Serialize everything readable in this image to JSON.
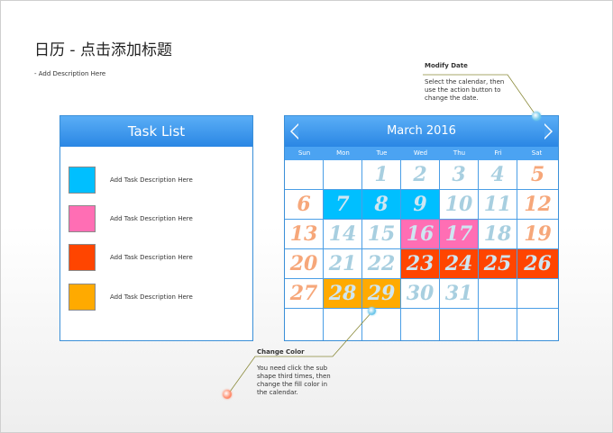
{
  "title": "日历 - 点击添加标题",
  "subtitle": "- Add Description Here",
  "task_list": {
    "header": "Task List",
    "items": [
      {
        "color": "#00bfff",
        "label": "Add Task  Description Here"
      },
      {
        "color": "#ff6eb4",
        "label": "Add Task  Description Here"
      },
      {
        "color": "#ff4500",
        "label": "Add Task  Description Here"
      },
      {
        "color": "#ffaa00",
        "label": "Add Task  Description Here"
      }
    ]
  },
  "calendar": {
    "month": "March 2016",
    "weekdays": [
      "Sun",
      "Mon",
      "Tue",
      "Wed",
      "Thu",
      "Fri",
      "Sat"
    ],
    "weeks": [
      [
        "",
        "",
        "1",
        "2",
        "3",
        "4",
        "5"
      ],
      [
        "6",
        "7",
        "8",
        "9",
        "10",
        "11",
        "12"
      ],
      [
        "13",
        "14",
        "15",
        "16",
        "17",
        "18",
        "19"
      ],
      [
        "20",
        "21",
        "22",
        "23",
        "24",
        "25",
        "26"
      ],
      [
        "27",
        "28",
        "29",
        "30",
        "31",
        "",
        ""
      ],
      [
        "",
        "",
        "",
        "",
        "",
        "",
        ""
      ]
    ],
    "colors": {
      "weekday_number": "#a8cfe0",
      "weekend_number": "#f6a77a",
      "highlight_number": "#cfe6f2"
    },
    "highlights": [
      {
        "day": "7",
        "color": "#00bfff"
      },
      {
        "day": "8",
        "color": "#00bfff"
      },
      {
        "day": "9",
        "color": "#00bfff"
      },
      {
        "day": "16",
        "color": "#ff6eb4"
      },
      {
        "day": "17",
        "color": "#ff6eb4"
      },
      {
        "day": "23",
        "color": "#ff4500"
      },
      {
        "day": "24",
        "color": "#ff4500"
      },
      {
        "day": "25",
        "color": "#ff4500"
      },
      {
        "day": "26",
        "color": "#ff4500"
      },
      {
        "day": "28",
        "color": "#ffaa00"
      },
      {
        "day": "29",
        "color": "#ffaa00"
      }
    ]
  },
  "notes": {
    "modify_date": {
      "title": "Modify Date",
      "text": "Select the calendar, then use the action button to change the date.",
      "dot_color": "#6cc6ea"
    },
    "change_color": {
      "title": "Change Color",
      "text": "You need click the sub shape third times, then change the fill color in the calendar.",
      "dot_color": "#ff8a6a",
      "dot2_color": "#6cc6ea"
    }
  }
}
